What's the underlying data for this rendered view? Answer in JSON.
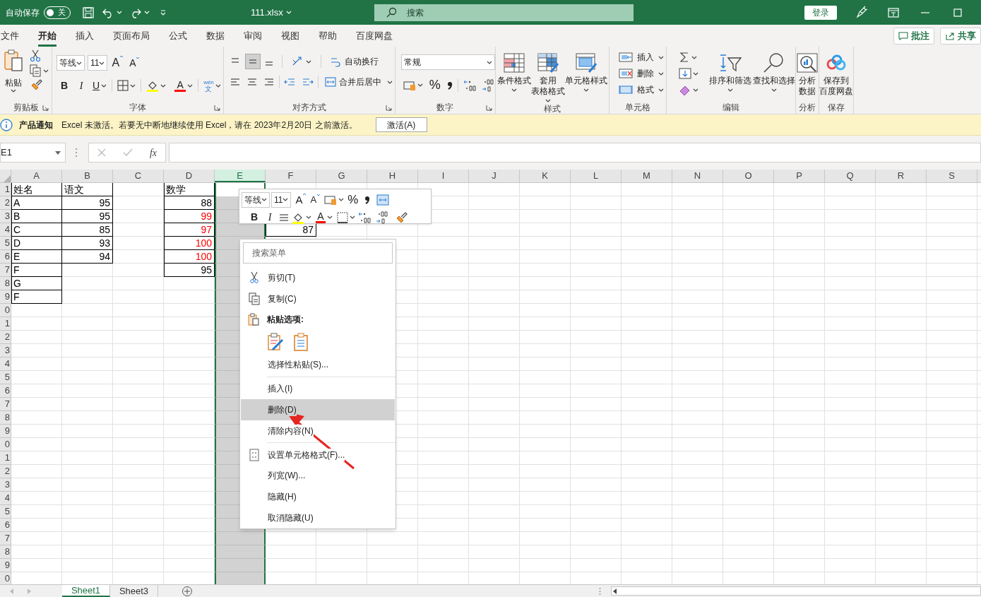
{
  "title_bar": {
    "autosave_label": "自动保存",
    "autosave": {
      "label": "关",
      "on": false
    },
    "filename": "111.xlsx",
    "search_placeholder": "搜索",
    "sign_in": "登录"
  },
  "ribbon_tabs": [
    {
      "label": "文件",
      "selected": false
    },
    {
      "label": "开始",
      "selected": true
    },
    {
      "label": "插入",
      "selected": false
    },
    {
      "label": "页面布局",
      "selected": false
    },
    {
      "label": "公式",
      "selected": false
    },
    {
      "label": "数据",
      "selected": false
    },
    {
      "label": "审阅",
      "selected": false
    },
    {
      "label": "视图",
      "selected": false
    },
    {
      "label": "帮助",
      "selected": false
    },
    {
      "label": "百度网盘",
      "selected": false
    }
  ],
  "ribbon_actions": [
    {
      "kind": "comments",
      "label": "批注"
    },
    {
      "kind": "share",
      "label": "共享"
    }
  ],
  "ribbon": {
    "clipboard": {
      "paste": "粘贴",
      "label": "剪贴板"
    },
    "font": {
      "font_name": "等线",
      "font_size": "11",
      "grow": "A",
      "shrink": "A",
      "bold": "B",
      "italic": "I",
      "underline": "U",
      "font_color": "A",
      "phonetic_top": "wén",
      "phonetic_bottom": "文",
      "label": "字体"
    },
    "alignment": {
      "wrap_text": "自动换行",
      "merge_center": "合并后居中",
      "label": "对齐方式"
    },
    "number": {
      "format": "常规",
      "percent": "%",
      "label": "数字"
    },
    "styles": {
      "buttons": [
        {
          "kind": "conditional",
          "lines": [
            "条件格式"
          ]
        },
        {
          "kind": "table",
          "lines": [
            "套用",
            "表格格式"
          ]
        },
        {
          "kind": "cell",
          "lines": [
            "单元格样式"
          ]
        }
      ],
      "label": "样式"
    },
    "cells": {
      "items": [
        {
          "kind": "insert",
          "label": "插入"
        },
        {
          "kind": "delete",
          "label": "删除"
        },
        {
          "kind": "format",
          "label": "格式"
        }
      ],
      "label": "单元格"
    },
    "editing": {
      "buttons": [
        {
          "kind": "sort",
          "label": "排序和筛选"
        },
        {
          "kind": "find",
          "label": "查找和选择"
        }
      ],
      "label": "编辑"
    },
    "analysis": {
      "lines": [
        "分析",
        "数据"
      ],
      "label": "分析"
    },
    "save": {
      "lines": [
        "保存到",
        "百度网盘"
      ],
      "label": "保存"
    }
  },
  "notification": {
    "title": "产品通知",
    "message": "Excel 未激活。若要无中断地继续使用 Excel，请在 2023年2月20日 之前激活。",
    "button": "激活(A)"
  },
  "formula_bar": {
    "name_box": "E1",
    "function_label": "fx"
  },
  "sheet": {
    "columns": [
      {
        "label": "A",
        "selected": false
      },
      {
        "label": "B",
        "selected": false
      },
      {
        "label": "C",
        "selected": false
      },
      {
        "label": "D",
        "selected": false
      },
      {
        "label": "E",
        "selected": true
      },
      {
        "label": "F",
        "selected": false
      },
      {
        "label": "G",
        "selected": false
      },
      {
        "label": "H",
        "selected": false
      },
      {
        "label": "I",
        "selected": false
      },
      {
        "label": "J",
        "selected": false
      },
      {
        "label": "K",
        "selected": false
      },
      {
        "label": "L",
        "selected": false
      },
      {
        "label": "M",
        "selected": false
      },
      {
        "label": "N",
        "selected": false
      },
      {
        "label": "O",
        "selected": false
      },
      {
        "label": "P",
        "selected": false
      },
      {
        "label": "Q",
        "selected": false
      },
      {
        "label": "R",
        "selected": false
      },
      {
        "label": "S",
        "selected": false
      }
    ],
    "rows": [
      {
        "label": "1",
        "cells": {
          "A": {
            "text": "姓名",
            "kind": "text",
            "color": "#000000"
          },
          "B": {
            "text": "语文",
            "kind": "text",
            "color": "#000000"
          },
          "D": {
            "text": "数学",
            "kind": "text",
            "color": "#000000"
          }
        }
      },
      {
        "label": "2",
        "cells": {
          "A": {
            "text": "A",
            "kind": "text",
            "color": "#000000"
          },
          "B": {
            "text": "95",
            "kind": "number",
            "color": "#000000"
          },
          "D": {
            "text": "88",
            "kind": "number",
            "color": "#000000"
          }
        }
      },
      {
        "label": "3",
        "cells": {
          "A": {
            "text": "B",
            "kind": "text",
            "color": "#000000"
          },
          "B": {
            "text": "95",
            "kind": "number",
            "color": "#000000"
          },
          "D": {
            "text": "99",
            "kind": "number",
            "color": "#ff0000"
          }
        }
      },
      {
        "label": "4",
        "cells": {
          "A": {
            "text": "C",
            "kind": "text",
            "color": "#000000"
          },
          "B": {
            "text": "85",
            "kind": "number",
            "color": "#000000"
          },
          "D": {
            "text": "97",
            "kind": "number",
            "color": "#ff0000"
          },
          "F": {
            "text": "87",
            "kind": "number",
            "color": "#000000"
          }
        }
      },
      {
        "label": "5",
        "cells": {
          "A": {
            "text": "D",
            "kind": "text",
            "color": "#000000"
          },
          "B": {
            "text": "93",
            "kind": "number",
            "color": "#000000"
          },
          "D": {
            "text": "100",
            "kind": "number",
            "color": "#ff0000"
          }
        }
      },
      {
        "label": "6",
        "cells": {
          "A": {
            "text": "E",
            "kind": "text",
            "color": "#000000"
          },
          "B": {
            "text": "94",
            "kind": "number",
            "color": "#000000"
          },
          "D": {
            "text": "100",
            "kind": "number",
            "color": "#ff0000"
          }
        }
      },
      {
        "label": "7",
        "cells": {
          "A": {
            "text": "F",
            "kind": "text",
            "color": "#000000"
          },
          "D": {
            "text": "95",
            "kind": "number",
            "color": "#000000"
          }
        }
      },
      {
        "label": "8",
        "cells": {
          "A": {
            "text": "G",
            "kind": "text",
            "color": "#000000"
          }
        }
      },
      {
        "label": "9",
        "cells": {
          "A": {
            "text": "F",
            "kind": "text",
            "color": "#000000"
          }
        }
      },
      {
        "label": "0"
      },
      {
        "label": "1"
      },
      {
        "label": "2"
      },
      {
        "label": "3"
      },
      {
        "label": "4"
      },
      {
        "label": "5"
      },
      {
        "label": "6"
      },
      {
        "label": "7"
      },
      {
        "label": "8"
      },
      {
        "label": "9"
      },
      {
        "label": "0"
      },
      {
        "label": "1"
      },
      {
        "label": "2"
      },
      {
        "label": "3"
      },
      {
        "label": "4"
      },
      {
        "label": "5"
      },
      {
        "label": "6"
      },
      {
        "label": "7"
      },
      {
        "label": "8"
      },
      {
        "label": "9"
      },
      {
        "label": "0"
      }
    ]
  },
  "mini_toolbar": {
    "font_name": "等线",
    "font_size": "11",
    "grow": "A",
    "shrink": "A",
    "percent": "%",
    "bold": "B",
    "italic": "I",
    "font_color": "A"
  },
  "context_menu": {
    "search_placeholder": "搜索菜单",
    "items": [
      {
        "kind": "item",
        "label": "剪切(T)",
        "selected": false
      },
      {
        "kind": "item",
        "label": "复制(C)",
        "selected": false
      },
      {
        "kind": "header",
        "label": "粘贴选项:"
      },
      {
        "kind": "paste_options"
      },
      {
        "kind": "item",
        "label": "选择性粘贴(S)...",
        "selected": false
      },
      {
        "kind": "separator"
      },
      {
        "kind": "item",
        "label": "插入(I)",
        "selected": false
      },
      {
        "kind": "item",
        "label": "删除(D)",
        "selected": true
      },
      {
        "kind": "item",
        "label": "清除内容(N)",
        "selected": false
      },
      {
        "kind": "separator"
      },
      {
        "kind": "item",
        "label": "设置单元格格式(F)...",
        "selected": false
      },
      {
        "kind": "item",
        "label": "列宽(W)...",
        "selected": false
      },
      {
        "kind": "item",
        "label": "隐藏(H)",
        "selected": false
      },
      {
        "kind": "item",
        "label": "取消隐藏(U)",
        "selected": false
      }
    ]
  },
  "sheet_tabs": [
    {
      "label": "Sheet1",
      "selected": true
    },
    {
      "label": "Sheet3",
      "selected": false
    }
  ]
}
